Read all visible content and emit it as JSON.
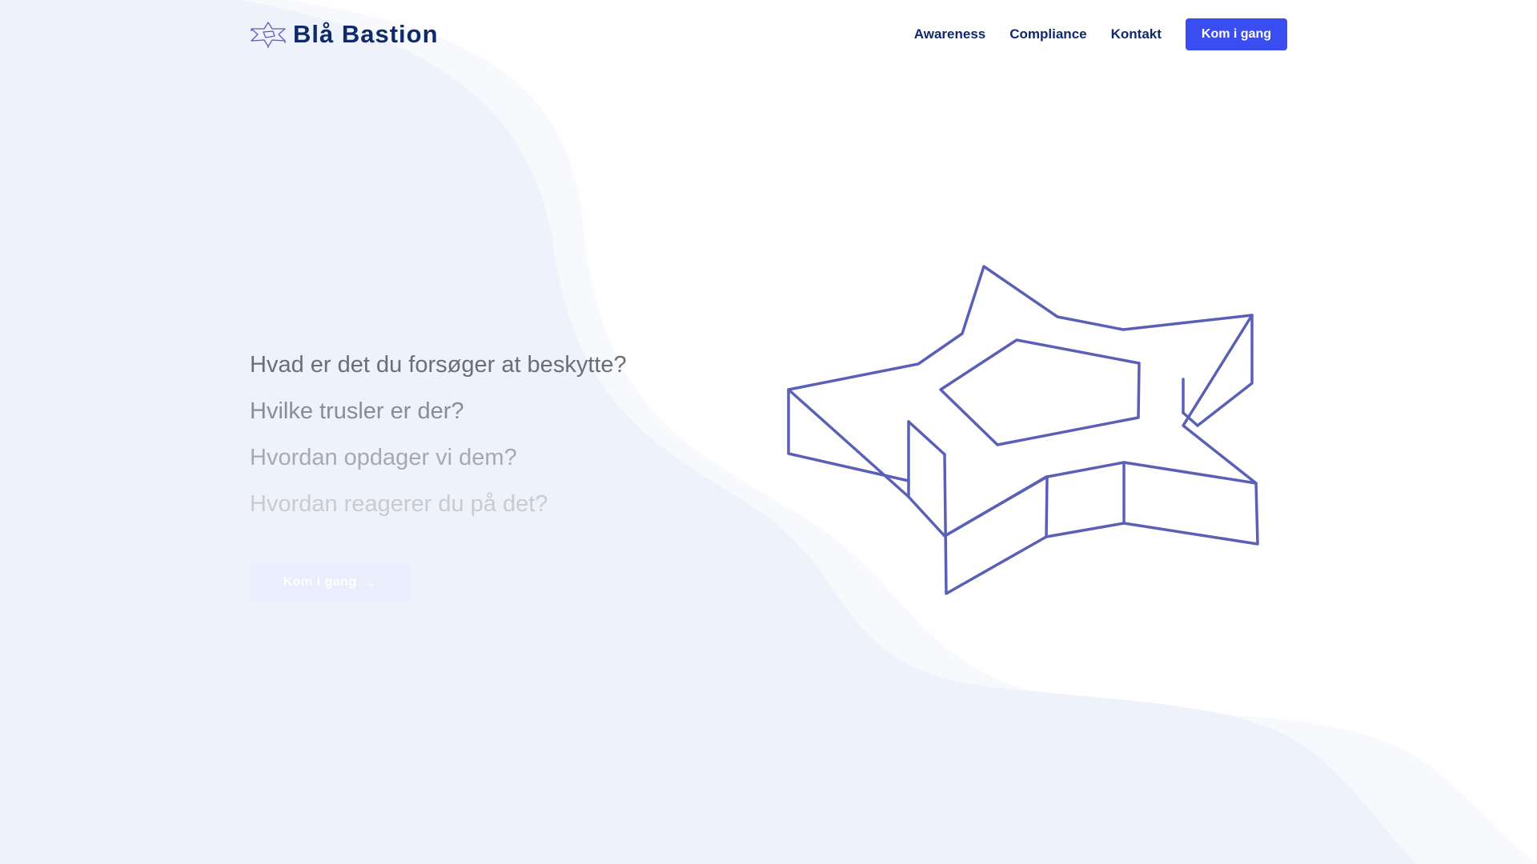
{
  "brand": {
    "name": "Blå Bastion",
    "logo_icon": "star-fortress-icon"
  },
  "nav": {
    "items": [
      {
        "label": "Awareness"
      },
      {
        "label": "Compliance"
      },
      {
        "label": "Kontakt"
      }
    ],
    "cta_label": "Kom i gang"
  },
  "hero": {
    "questions": [
      "Hvad er det du forsøger at beskytte?",
      "Hvilke trusler er der?",
      "Hvordan opdager vi dem?",
      "Hvordan reagerer du på det?"
    ],
    "button_label": "Kom i gang",
    "button_icon": "arrow-right-icon"
  },
  "illustration": {
    "icon": "star-fortress-icon"
  },
  "colors": {
    "brand_navy": "#0f2a6b",
    "accent": "#3a4df0",
    "wave": "#eef2fb",
    "illustration_stroke": "#5a60b5"
  }
}
